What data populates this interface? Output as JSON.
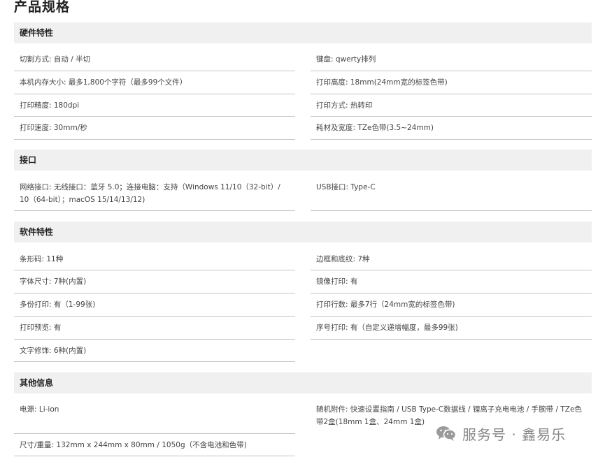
{
  "title": "产品规格",
  "sections": [
    {
      "name": "硬件特性",
      "left": [
        "切割方式: 自动 / 半切",
        "本机内存大小: 最多1,800个字符（最多99个文件）",
        "打印精度: 180dpi",
        "打印速度: 30mm/秒"
      ],
      "right": [
        "键盘: qwerty排列",
        "打印高度: 18mm(24mm宽的标签色带)",
        "打印方式: 热转印",
        "耗材及宽度: TZe色带(3.5~24mm)"
      ]
    },
    {
      "name": "接口",
      "left": [
        "网络接口: 无线接口：蓝牙 5.0；连接电脑：支持（Windows 11/10（32-bit）/ 10（64-bit）；macOS 15/14/13/12)"
      ],
      "right": [
        "USB接口: Type-C"
      ]
    },
    {
      "name": "软件特性",
      "left": [
        "条形码: 11种",
        "字体尺寸: 7种(内置)",
        "多份打印: 有（1-99张)",
        "打印预览: 有",
        "文字修饰: 6种(内置)"
      ],
      "right": [
        "边框和底纹: 7种",
        "镜像打印: 有",
        "打印行数: 最多7行（24mm宽的标签色带)",
        "序号打印: 有（自定义递增幅度，最多99张)"
      ]
    },
    {
      "name": "其他信息",
      "left": [
        "电源: Li-ion",
        "尺寸/重量: 132mm x 244mm x 80mm / 1050g（不含电池和色带)"
      ],
      "right": [
        "随机附件: 快速设置指南 / USB Type-C数据线 / 锂离子充电电池 / 手腕带 / TZe色带2盒(18mm 1盒、24mm 1盒)"
      ]
    }
  ],
  "watermark": {
    "icon": "wechat-icon",
    "text": "服务号 · 鑫易乐"
  }
}
